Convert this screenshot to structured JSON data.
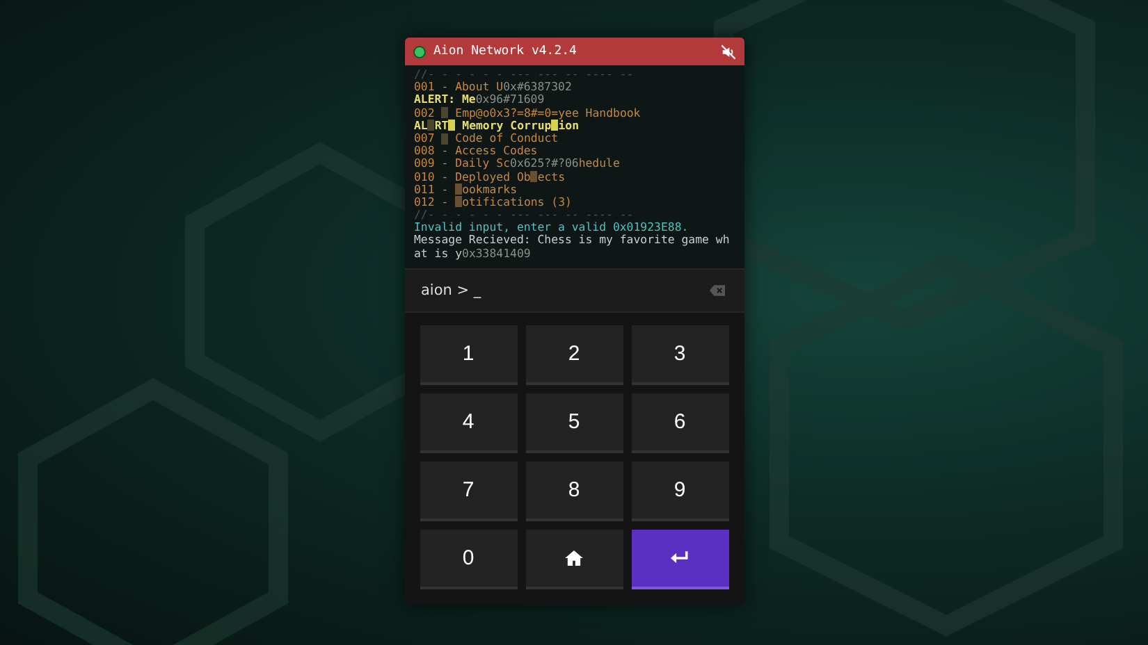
{
  "window": {
    "title": "Aion Network v4.2.4"
  },
  "terminal": {
    "lines": [
      [
        {
          "kind": "separator",
          "text": "//- - - - - - --- --- -- ---- --"
        }
      ],
      [
        {
          "kind": "menu",
          "text": "001 - About U"
        },
        {
          "kind": "noise",
          "text": "0x#6387302"
        }
      ],
      [
        {
          "kind": "alert",
          "text": "ALERT: Me"
        },
        {
          "kind": "noise",
          "text": "0x96#71609"
        }
      ],
      [
        {
          "kind": "menu",
          "text": "002 "
        },
        {
          "kind": "block",
          "color": "#4a4630"
        },
        {
          "kind": "menu",
          "text": " Emp@o0x3?=8#=0=yee Handbook"
        }
      ],
      [
        {
          "kind": "alert",
          "text": "AL"
        },
        {
          "kind": "block",
          "color": "#4a4630"
        },
        {
          "kind": "alert",
          "text": "RT"
        },
        {
          "kind": "block",
          "color": "#d8d050"
        },
        {
          "kind": "alert",
          "text": " Memory Corrup"
        },
        {
          "kind": "block",
          "color": "#d8d050"
        },
        {
          "kind": "alert",
          "text": "ion"
        }
      ],
      [
        {
          "kind": "menu",
          "text": "007 "
        },
        {
          "kind": "block",
          "color": "#4a4630"
        },
        {
          "kind": "menu",
          "text": " Code of Conduct"
        }
      ],
      [
        {
          "kind": "menu",
          "text": "008 - Access Codes"
        }
      ],
      [
        {
          "kind": "menu",
          "text": "009 - Daily Sc"
        },
        {
          "kind": "noise",
          "text": "0x625?#?06"
        },
        {
          "kind": "menu",
          "text": "hedule"
        }
      ],
      [
        {
          "kind": "menu",
          "text": "010 - Deployed Ob"
        },
        {
          "kind": "block",
          "color": "#6a5030"
        },
        {
          "kind": "menu",
          "text": "ects"
        }
      ],
      [
        {
          "kind": "menu",
          "text": "011 - "
        },
        {
          "kind": "block",
          "color": "#6a5030"
        },
        {
          "kind": "menu",
          "text": "ookmarks"
        }
      ],
      [
        {
          "kind": "menu",
          "text": "012 - "
        },
        {
          "kind": "block",
          "color": "#6a5030"
        },
        {
          "kind": "menu",
          "text": "otifications (3)"
        }
      ],
      [
        {
          "kind": "separator",
          "text": "//- - - - - - --- --- -- ---- --"
        }
      ],
      [
        {
          "kind": "error",
          "text": "Invalid input, enter a valid 0x01923E88."
        }
      ],
      [
        {
          "kind": "message",
          "text": "Message Recieved: Chess is my favorite game wh"
        }
      ],
      [
        {
          "kind": "message",
          "text": "at is y"
        },
        {
          "kind": "noise",
          "text": "0x33841409"
        }
      ]
    ]
  },
  "input": {
    "prompt": "aion > _"
  },
  "keys": [
    {
      "kind": "digit",
      "label": "1"
    },
    {
      "kind": "digit",
      "label": "2"
    },
    {
      "kind": "digit",
      "label": "3"
    },
    {
      "kind": "digit",
      "label": "4"
    },
    {
      "kind": "digit",
      "label": "5"
    },
    {
      "kind": "digit",
      "label": "6"
    },
    {
      "kind": "digit",
      "label": "7"
    },
    {
      "kind": "digit",
      "label": "8"
    },
    {
      "kind": "digit",
      "label": "9"
    },
    {
      "kind": "digit",
      "label": "0"
    },
    {
      "kind": "home"
    },
    {
      "kind": "enter"
    }
  ]
}
